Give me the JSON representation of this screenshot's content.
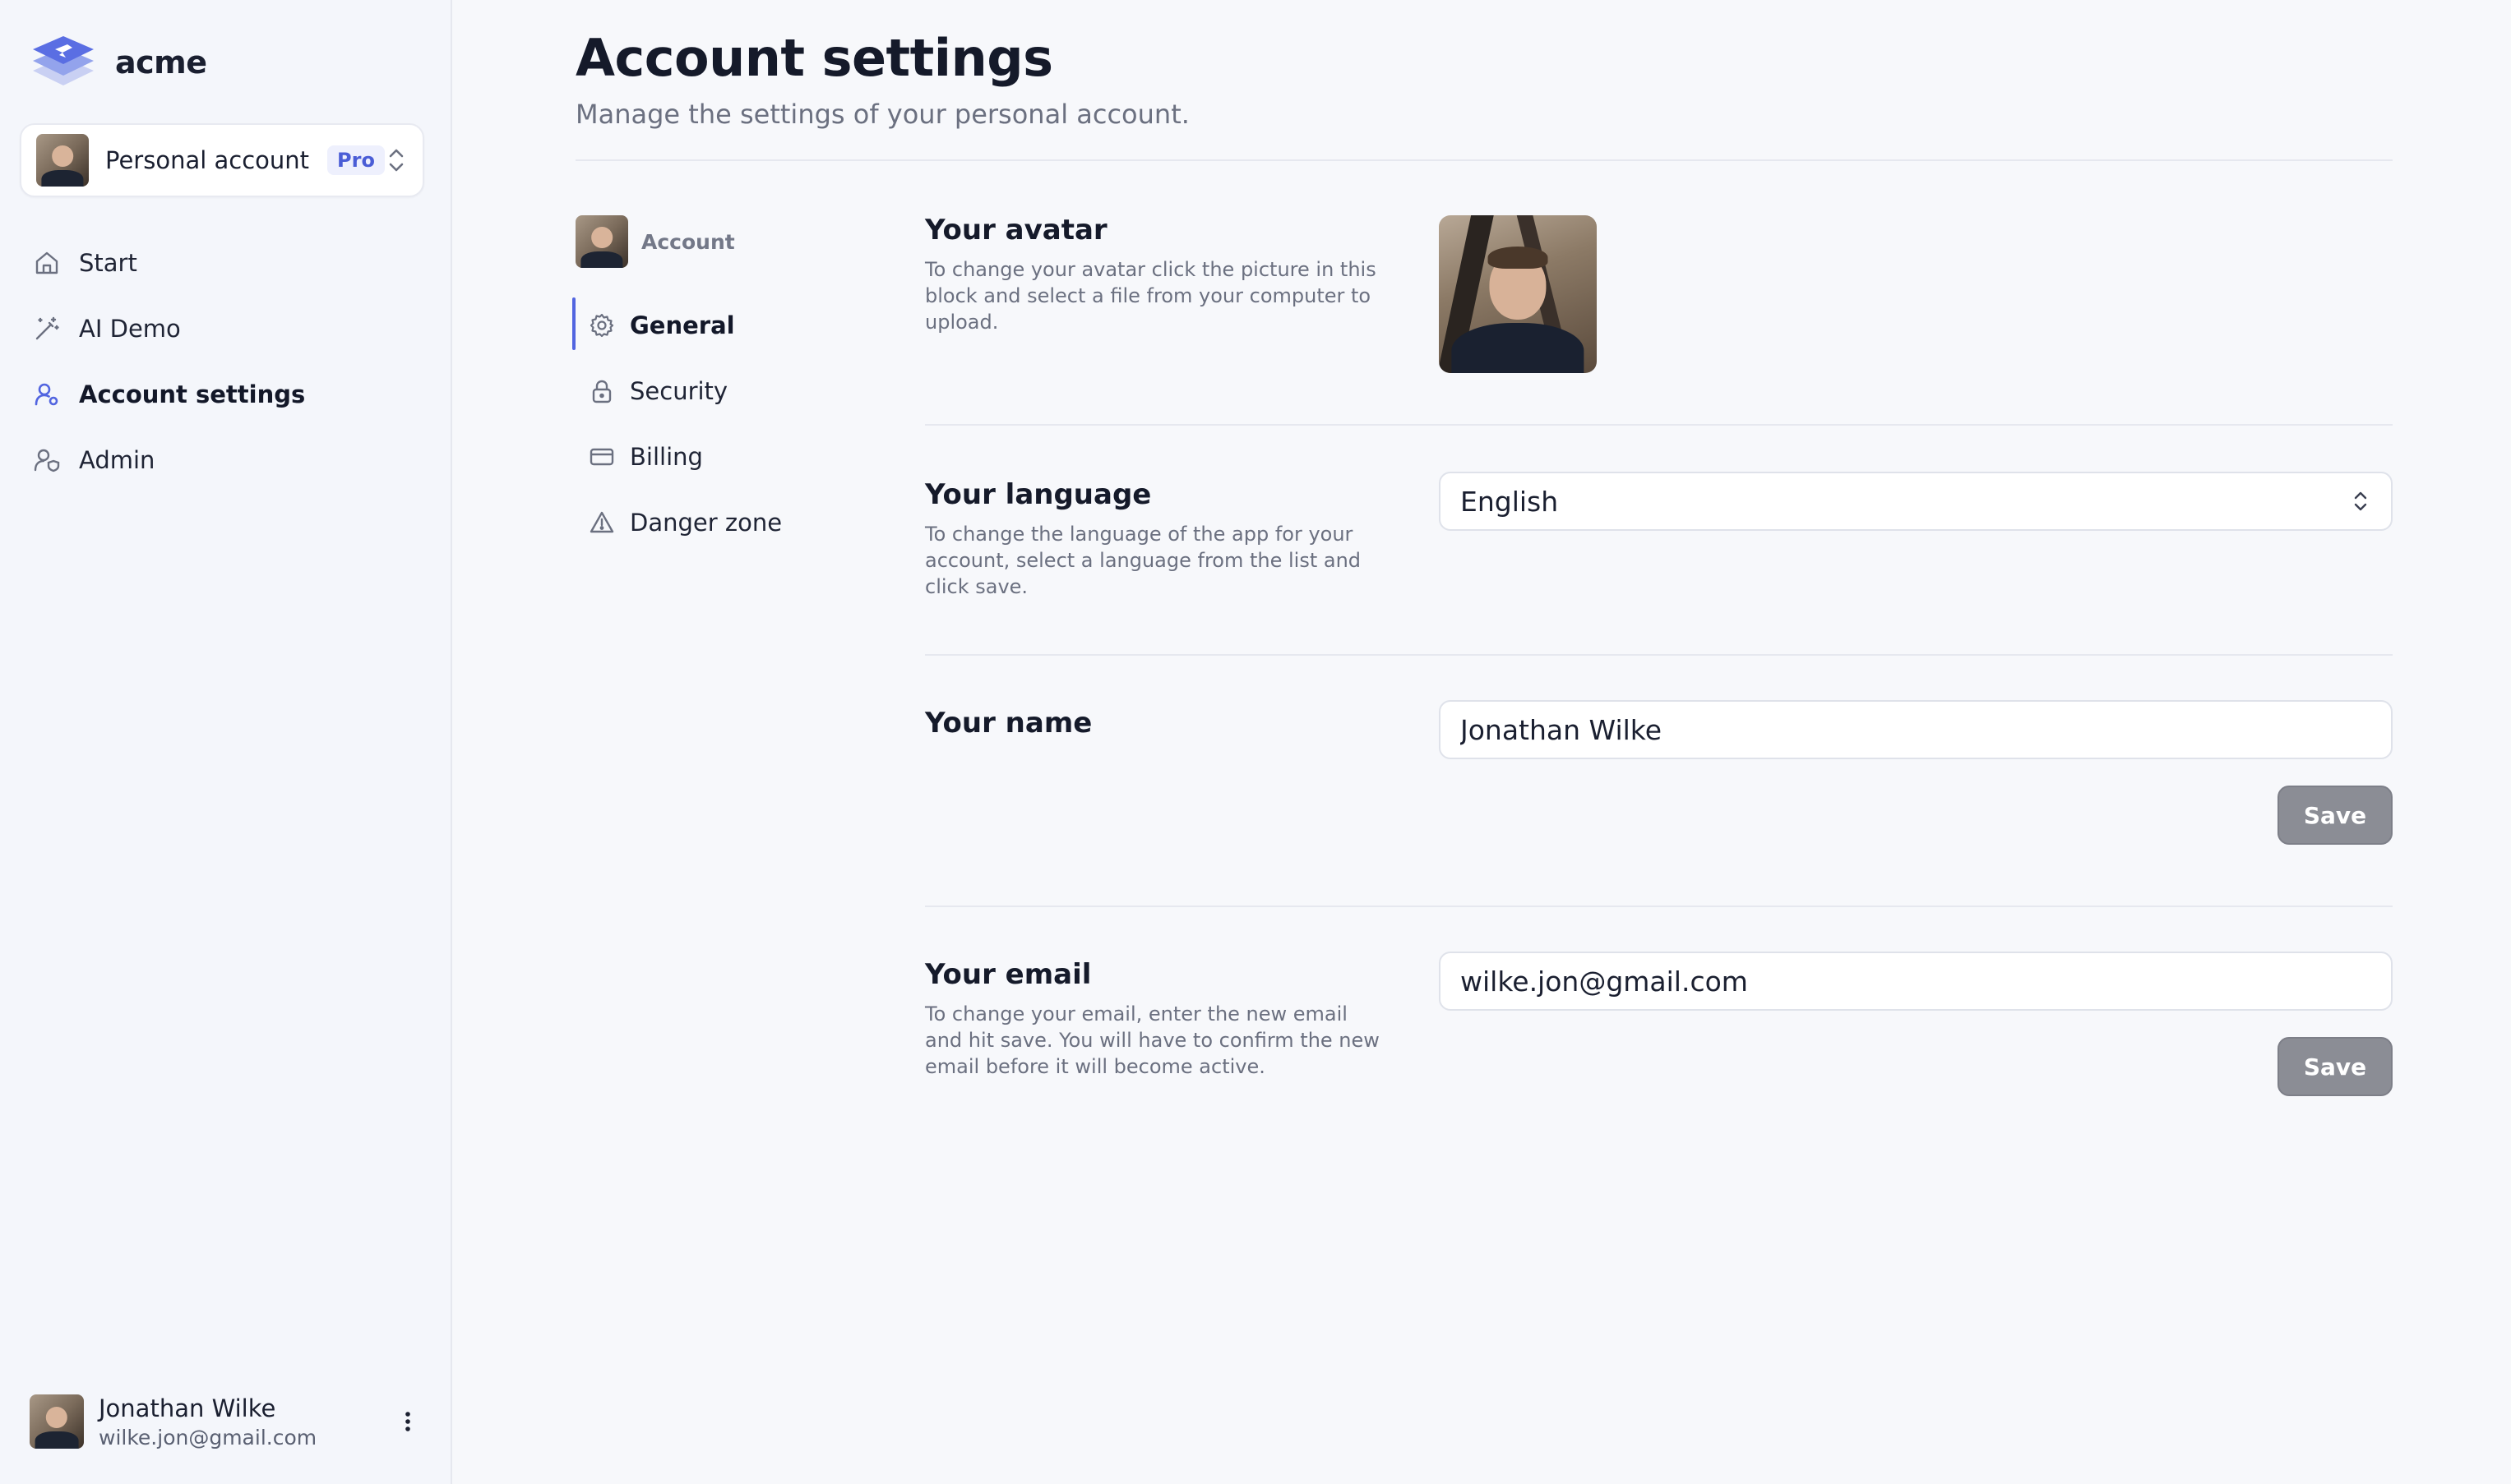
{
  "brand": {
    "name": "acme"
  },
  "account_switcher": {
    "label": "Personal account",
    "badge": "Pro"
  },
  "nav": [
    {
      "label": "Start",
      "icon": "home-icon"
    },
    {
      "label": "AI Demo",
      "icon": "magic-wand-icon"
    },
    {
      "label": "Account settings",
      "icon": "user-settings-icon",
      "active": true
    },
    {
      "label": "Admin",
      "icon": "user-shield-icon"
    }
  ],
  "user": {
    "name": "Jonathan Wilke",
    "email": "wilke.jon@gmail.com"
  },
  "page": {
    "title": "Account settings",
    "subtitle": "Manage the settings of your personal account."
  },
  "sub_nav": {
    "head": "Account",
    "items": [
      {
        "label": "General",
        "icon": "gear-icon",
        "active": true
      },
      {
        "label": "Security",
        "icon": "lock-icon"
      },
      {
        "label": "Billing",
        "icon": "credit-card-icon"
      },
      {
        "label": "Danger zone",
        "icon": "warning-icon"
      }
    ]
  },
  "sections": {
    "avatar": {
      "title": "Your avatar",
      "description": "To change your avatar click the picture in this block and select a file from your computer to upload."
    },
    "language": {
      "title": "Your language",
      "description": "To change the language of the app for your account, select a language from the list and click save.",
      "value": "English"
    },
    "name": {
      "title": "Your name",
      "value": "Jonathan Wilke",
      "save_label": "Save"
    },
    "email": {
      "title": "Your email",
      "description": "To change your email, enter the new email and hit save. You will have to confirm the new email before it will become active.",
      "value": "wilke.jon@gmail.com",
      "save_label": "Save"
    }
  },
  "colors": {
    "accent": "#5265e0",
    "badge_text": "#4a5dd6",
    "save_button": "#8b8d95"
  }
}
